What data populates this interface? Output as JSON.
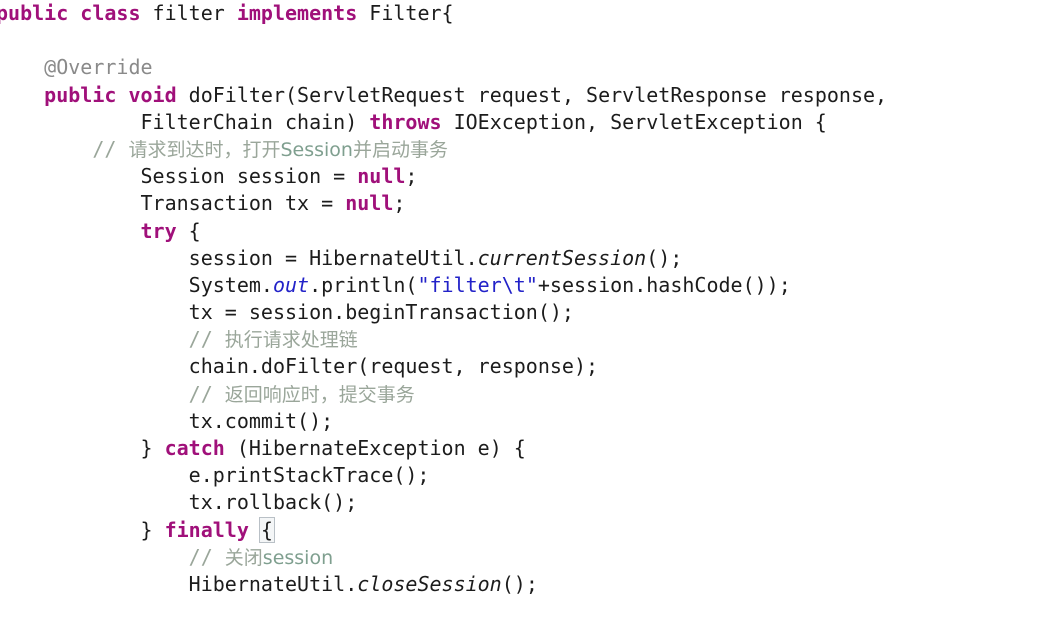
{
  "editor": {
    "language": "java",
    "background_color": "#ffffff",
    "foreground_color": "#1c1c1c",
    "keyword_color": "#A0107A",
    "comment_color": "#9aa69a",
    "string_color": "#2222C8",
    "static_field_color": "#2222C8",
    "annotation_color": "#8a8a8a",
    "bracket_match_color": "#b9c0c6",
    "font_size_px": 20,
    "line_height_px": 27.2
  },
  "code": {
    "lines": [
      {
        "index": 1,
        "indent": "",
        "text": "public class filter implements Filter{",
        "tokens": [
          {
            "t": "public",
            "k": "kw"
          },
          {
            "t": " ",
            "k": "plain"
          },
          {
            "t": "class",
            "k": "kw"
          },
          {
            "t": " filter ",
            "k": "plain"
          },
          {
            "t": "implements",
            "k": "kw"
          },
          {
            "t": " Filter{",
            "k": "plain"
          }
        ]
      },
      {
        "index": 2,
        "indent": "",
        "text": "",
        "tokens": []
      },
      {
        "index": 3,
        "indent": "    ",
        "text": "    @Override",
        "tokens": [
          {
            "t": "    ",
            "k": "plain"
          },
          {
            "t": "@Override",
            "k": "ann"
          }
        ]
      },
      {
        "index": 4,
        "indent": "    ",
        "text": "    public void doFilter(ServletRequest request, ServletResponse response,",
        "tokens": [
          {
            "t": "    ",
            "k": "plain"
          },
          {
            "t": "public",
            "k": "kw"
          },
          {
            "t": " ",
            "k": "plain"
          },
          {
            "t": "void",
            "k": "kw"
          },
          {
            "t": " doFilter(ServletRequest request, ServletResponse response,",
            "k": "plain"
          }
        ]
      },
      {
        "index": 5,
        "indent": "            ",
        "text": "            FilterChain chain) throws IOException, ServletException {",
        "tokens": [
          {
            "t": "            FilterChain chain) ",
            "k": "plain"
          },
          {
            "t": "throws",
            "k": "kw"
          },
          {
            "t": " IOException, ServletException {",
            "k": "plain"
          }
        ]
      },
      {
        "index": 6,
        "indent": "        ",
        "text": "        // 请求到达时，打开Session并启动事务",
        "tokens": [
          {
            "t": "        ",
            "k": "plain"
          },
          {
            "t": "// ",
            "k": "cmt"
          },
          {
            "t": "请求到达时，打开",
            "k": "cmt-cn"
          },
          {
            "t": "Session",
            "k": "cmt-en"
          },
          {
            "t": "并启动事务",
            "k": "cmt-cn"
          }
        ]
      },
      {
        "index": 7,
        "indent": "            ",
        "text": "            Session session = null;",
        "tokens": [
          {
            "t": "            Session session = ",
            "k": "plain"
          },
          {
            "t": "null",
            "k": "kw"
          },
          {
            "t": ";",
            "k": "plain"
          }
        ]
      },
      {
        "index": 8,
        "indent": "            ",
        "text": "            Transaction tx = null;",
        "tokens": [
          {
            "t": "            Transaction tx = ",
            "k": "plain"
          },
          {
            "t": "null",
            "k": "kw"
          },
          {
            "t": ";",
            "k": "plain"
          }
        ]
      },
      {
        "index": 9,
        "indent": "            ",
        "text": "            try {",
        "tokens": [
          {
            "t": "            ",
            "k": "plain"
          },
          {
            "t": "try",
            "k": "kw"
          },
          {
            "t": " {",
            "k": "plain"
          }
        ]
      },
      {
        "index": 10,
        "indent": "                ",
        "text": "                session = HibernateUtil.currentSession();",
        "tokens": [
          {
            "t": "                session = HibernateUtil.",
            "k": "plain"
          },
          {
            "t": "currentSession",
            "k": "mstatic"
          },
          {
            "t": "();",
            "k": "plain"
          }
        ]
      },
      {
        "index": 11,
        "indent": "                ",
        "text": "                System.out.println(\"filter\\t\"+session.hashCode());",
        "tokens": [
          {
            "t": "                System.",
            "k": "plain"
          },
          {
            "t": "out",
            "k": "field"
          },
          {
            "t": ".println(",
            "k": "plain"
          },
          {
            "t": "\"filter\\t\"",
            "k": "str"
          },
          {
            "t": "+session.hashCode());",
            "k": "plain"
          }
        ]
      },
      {
        "index": 12,
        "indent": "                ",
        "text": "                tx = session.beginTransaction();",
        "tokens": [
          {
            "t": "                tx = session.beginTransaction();",
            "k": "plain"
          }
        ]
      },
      {
        "index": 13,
        "indent": "                ",
        "text": "                // 执行请求处理链",
        "tokens": [
          {
            "t": "                ",
            "k": "plain"
          },
          {
            "t": "// ",
            "k": "cmt"
          },
          {
            "t": "执行请求处理链",
            "k": "cmt-cn"
          }
        ]
      },
      {
        "index": 14,
        "indent": "                ",
        "text": "                chain.doFilter(request, response);",
        "tokens": [
          {
            "t": "                chain.doFilter(request, response);",
            "k": "plain"
          }
        ]
      },
      {
        "index": 15,
        "indent": "                ",
        "text": "                // 返回响应时，提交事务",
        "tokens": [
          {
            "t": "                ",
            "k": "plain"
          },
          {
            "t": "// ",
            "k": "cmt"
          },
          {
            "t": "返回响应时，提交事务",
            "k": "cmt-cn"
          }
        ]
      },
      {
        "index": 16,
        "indent": "                ",
        "text": "                tx.commit();",
        "tokens": [
          {
            "t": "                tx.commit();",
            "k": "plain"
          }
        ]
      },
      {
        "index": 17,
        "indent": "            ",
        "text": "            } catch (HibernateException e) {",
        "tokens": [
          {
            "t": "            } ",
            "k": "plain"
          },
          {
            "t": "catch",
            "k": "kw"
          },
          {
            "t": " (HibernateException e) {",
            "k": "plain"
          }
        ]
      },
      {
        "index": 18,
        "indent": "                ",
        "text": "                e.printStackTrace();",
        "tokens": [
          {
            "t": "                e.printStackTrace();",
            "k": "plain"
          }
        ]
      },
      {
        "index": 19,
        "indent": "                ",
        "text": "                tx.rollback();",
        "tokens": [
          {
            "t": "                tx.rollback();",
            "k": "plain"
          }
        ]
      },
      {
        "index": 20,
        "indent": "            ",
        "text": "            } finally {",
        "tokens": [
          {
            "t": "            } ",
            "k": "plain"
          },
          {
            "t": "finally",
            "k": "kw"
          },
          {
            "t": " ",
            "k": "plain"
          },
          {
            "t": "{",
            "k": "brace-match"
          }
        ]
      },
      {
        "index": 21,
        "indent": "                ",
        "text": "                // 关闭session",
        "tokens": [
          {
            "t": "                ",
            "k": "plain"
          },
          {
            "t": "// ",
            "k": "cmt"
          },
          {
            "t": "关闭",
            "k": "cmt-cn"
          },
          {
            "t": "session",
            "k": "cmt-en"
          }
        ]
      },
      {
        "index": 22,
        "indent": "                ",
        "text": "                HibernateUtil.closeSession();",
        "tokens": [
          {
            "t": "                HibernateUtil.",
            "k": "plain"
          },
          {
            "t": "closeSession",
            "k": "mstatic"
          },
          {
            "t": "();",
            "k": "plain"
          }
        ]
      }
    ]
  }
}
